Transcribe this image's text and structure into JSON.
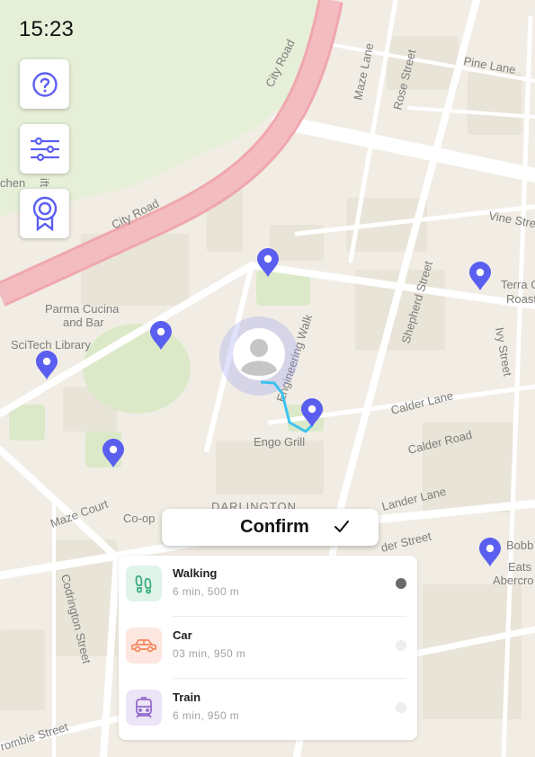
{
  "status_bar": {
    "time": "15:23"
  },
  "map_controls": [
    {
      "icon": "help-icon"
    },
    {
      "icon": "filter-sliders-icon"
    },
    {
      "icon": "badge-award-icon"
    }
  ],
  "map": {
    "labels": {
      "city_road_1": "City Road",
      "city_road_2": "City Road",
      "maze_lane": "Maze Lane",
      "rose_street": "Rose Street",
      "pine_lane": "Pine Lane",
      "vine_street": "Vine Stree",
      "chen": "chen",
      "terra_1": "Terra C",
      "terra_2": "Roast",
      "parma_1": "Parma Cucina",
      "parma_2": "and Bar",
      "scitech": "SciTech Library",
      "engineering_walk": "Engineering Walk",
      "shepherd_street": "Shepherd Street",
      "ivy_street": "Ivy Street",
      "calder_lane": "Calder Lane",
      "calder_road": "Calder Road",
      "engo_grill": "Engo Grill",
      "darlington": "DARLINGTON",
      "maze_court": "Maze Court",
      "coop": "Co-op",
      "lander_lane": "Lander Lane",
      "codrington_street": "Codrington Street",
      "der_street": "der Street",
      "bobbi_1": "Bobb",
      "bobbi_2": "Eats",
      "bobbi_3": "Abercro",
      "crombie_street": "rombie Street",
      "ift": "ift"
    },
    "marker_color": "#5b5ff0",
    "route_color": "#3cc3f0",
    "user_location": {
      "avatar": "user-avatar-icon"
    }
  },
  "confirm": {
    "label": "Confirm"
  },
  "transport_modes": [
    {
      "name": "Walking",
      "meta": "6 min, 500 m",
      "icon": "footsteps-icon",
      "selected": true,
      "icon_bg": "#dff3ea",
      "icon_color": "#3cae7d"
    },
    {
      "name": "Car",
      "meta": "03 min, 950 m",
      "icon": "car-icon",
      "selected": false,
      "icon_bg": "#fde6df",
      "icon_color": "#f2895f"
    },
    {
      "name": "Train",
      "meta": "6 min, 950 m",
      "icon": "train-icon",
      "selected": false,
      "icon_bg": "#ece4f7",
      "icon_color": "#9069c9"
    }
  ]
}
